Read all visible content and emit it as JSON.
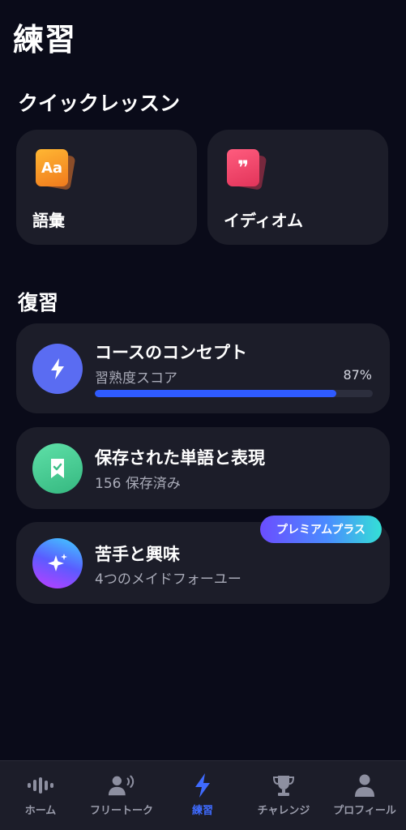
{
  "page": {
    "title": "練習"
  },
  "quick_lessons": {
    "heading": "クイックレッスン",
    "cards": [
      {
        "label": "語彙",
        "icon_text": "Aa",
        "icon": "vocabulary-card-icon"
      },
      {
        "label": "イディオム",
        "icon_text": "❞",
        "icon": "idiom-quote-icon"
      }
    ]
  },
  "review": {
    "heading": "復習",
    "course_concepts": {
      "title": "コースのコンセプト",
      "subtitle": "習熟度スコア",
      "percent_label": "87%",
      "progress": 0.87,
      "icon": "lightning-icon"
    },
    "saved_words": {
      "title": "保存された単語と表現",
      "subtitle": "156 保存済み",
      "icon": "bookmark-icon"
    },
    "weakness_interest": {
      "title": "苦手と興味",
      "subtitle": "4つのメイドフォーユー",
      "badge": "プレミアムプラス",
      "icon": "sparkle-icon"
    }
  },
  "nav": {
    "items": [
      {
        "label": "ホーム",
        "icon": "waveform-icon",
        "active": false
      },
      {
        "label": "フリートーク",
        "icon": "person-speaking-icon",
        "active": false
      },
      {
        "label": "練習",
        "icon": "lightning-icon",
        "active": true
      },
      {
        "label": "チャレンジ",
        "icon": "trophy-icon",
        "active": false
      },
      {
        "label": "プロフィール",
        "icon": "person-icon",
        "active": false
      }
    ]
  },
  "colors": {
    "background": "#0a0b19",
    "card": "#1c1d29",
    "accent": "#2f5bff",
    "active_nav": "#3f6bff"
  }
}
